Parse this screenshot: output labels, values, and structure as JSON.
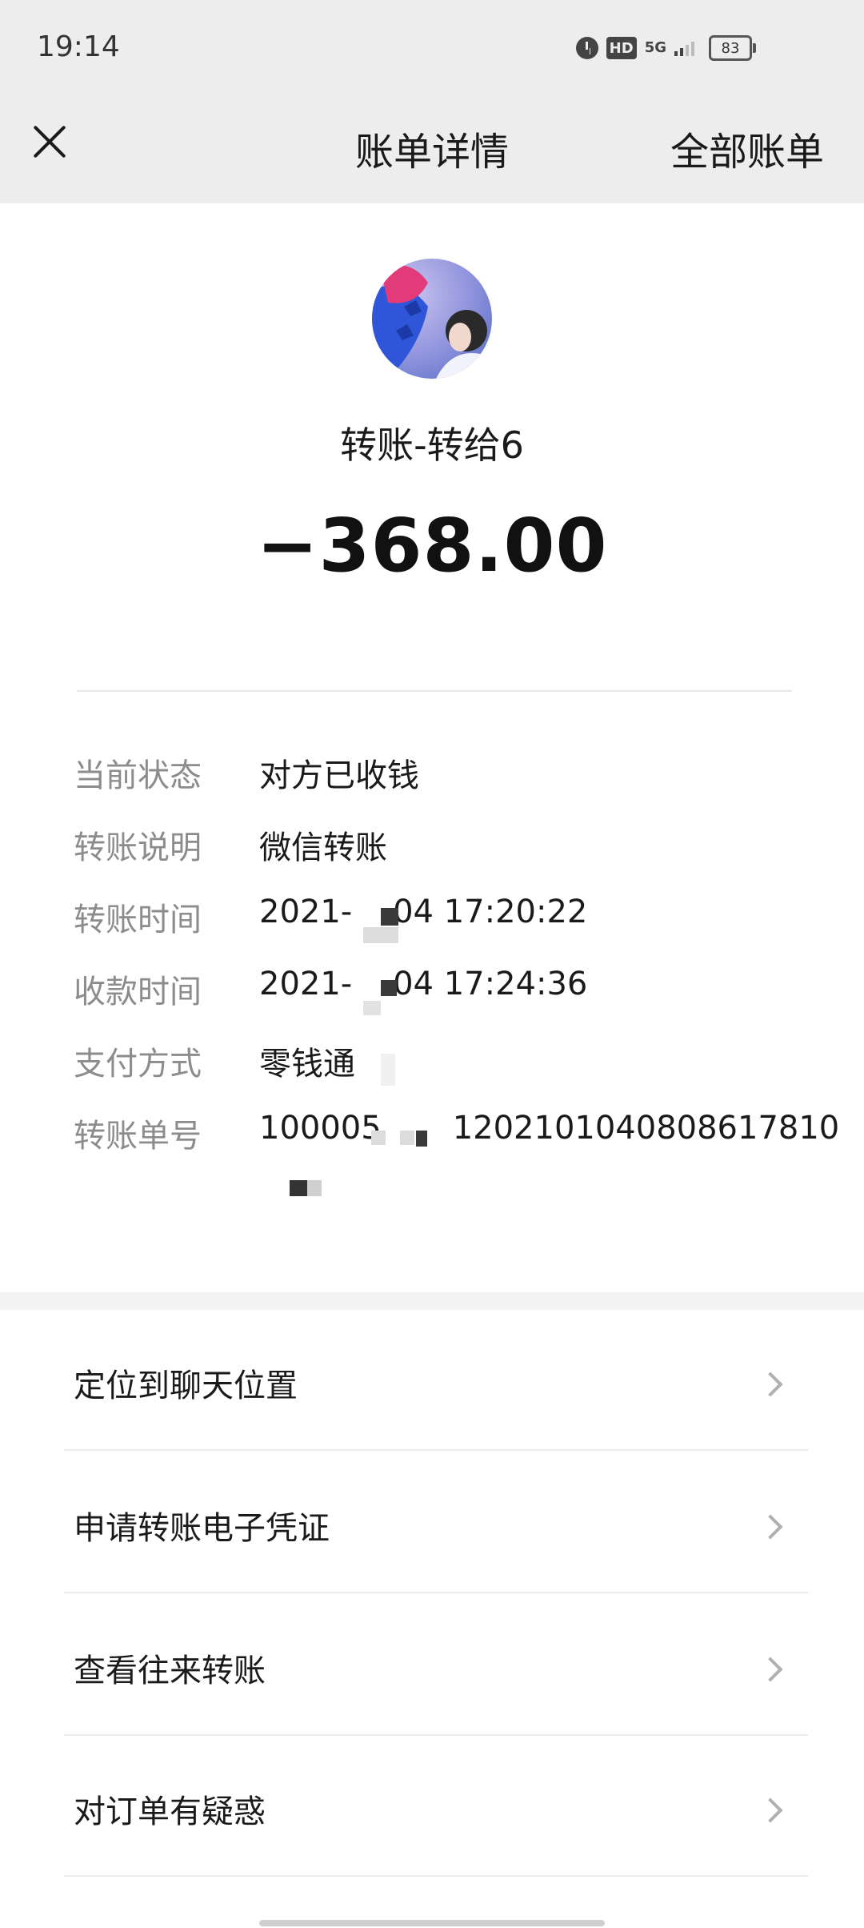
{
  "status_bar": {
    "time": "19:14",
    "hd_label": "HD",
    "network_label": "5G",
    "battery": "83"
  },
  "nav": {
    "title": "账单详情",
    "right_action": "全部账单"
  },
  "transaction": {
    "title": "转账-转给6",
    "amount": "−368.00"
  },
  "details": [
    {
      "label": "当前状态",
      "value": "对方已收钱"
    },
    {
      "label": "转账说明",
      "value": "微信转账"
    },
    {
      "label": "转账时间",
      "value": "2021-    04 17:20:22"
    },
    {
      "label": "收款时间",
      "value": "2021-    04 17:24:36"
    },
    {
      "label": "支付方式",
      "value": "零钱通"
    },
    {
      "label": "转账单号",
      "value": "100005       1202101040808617810"
    }
  ],
  "menu": [
    {
      "label": "定位到聊天位置"
    },
    {
      "label": "申请转账电子凭证"
    },
    {
      "label": "查看往来转账"
    },
    {
      "label": "对订单有疑惑"
    }
  ]
}
